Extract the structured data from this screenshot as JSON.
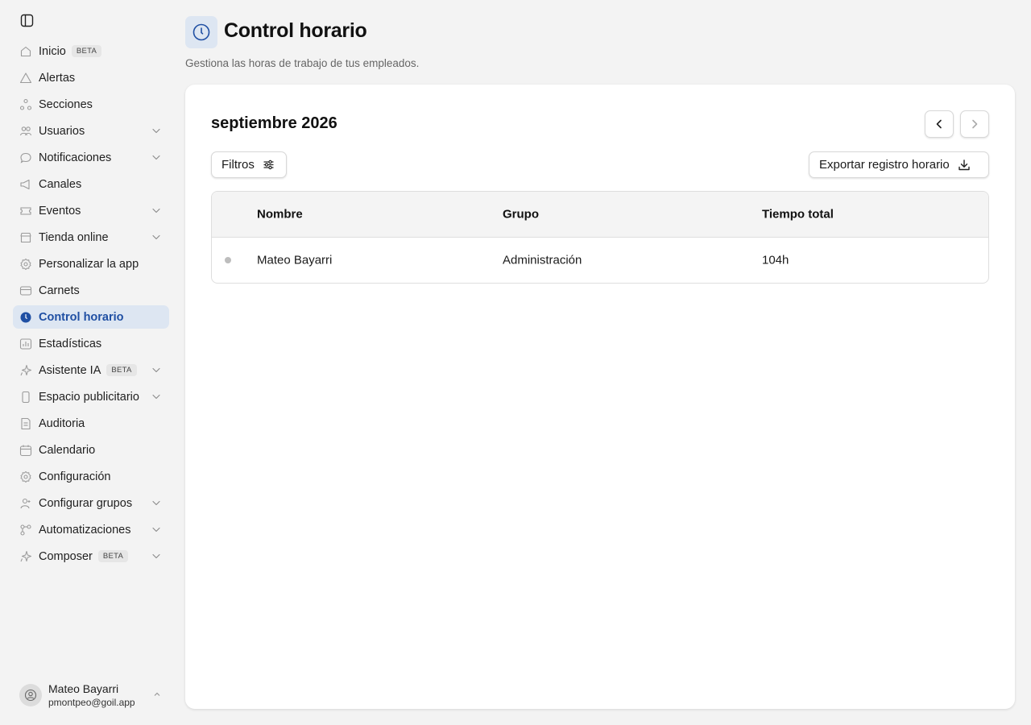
{
  "sidebar": {
    "items": [
      {
        "label": "Inicio",
        "icon": "home-icon",
        "badge": "BETA",
        "expandable": false
      },
      {
        "label": "Alertas",
        "icon": "alert-triangle-icon",
        "badge": "",
        "expandable": false
      },
      {
        "label": "Secciones",
        "icon": "sections-icon",
        "badge": "",
        "expandable": false
      },
      {
        "label": "Usuarios",
        "icon": "users-icon",
        "badge": "",
        "expandable": true
      },
      {
        "label": "Notificaciones",
        "icon": "message-bubble-icon",
        "badge": "",
        "expandable": true
      },
      {
        "label": "Canales",
        "icon": "megaphone-icon",
        "badge": "",
        "expandable": false
      },
      {
        "label": "Eventos",
        "icon": "ticket-icon",
        "badge": "",
        "expandable": true
      },
      {
        "label": "Tienda online",
        "icon": "store-icon",
        "badge": "",
        "expandable": true
      },
      {
        "label": "Personalizar la app",
        "icon": "settings-gear-icon",
        "badge": "",
        "expandable": false
      },
      {
        "label": "Carnets",
        "icon": "card-icon",
        "badge": "",
        "expandable": false
      },
      {
        "label": "Control horario",
        "icon": "clock-icon",
        "badge": "",
        "expandable": false,
        "active": true
      },
      {
        "label": "Estadísticas",
        "icon": "bar-chart-icon",
        "badge": "",
        "expandable": false
      },
      {
        "label": "Asistente IA",
        "icon": "sparkle-icon",
        "badge": "BETA",
        "expandable": true
      },
      {
        "label": "Espacio publicitario",
        "icon": "phone-icon",
        "badge": "",
        "expandable": true
      },
      {
        "label": "Auditoria",
        "icon": "audit-document-icon",
        "badge": "",
        "expandable": false
      },
      {
        "label": "Calendario",
        "icon": "calendar-icon",
        "badge": "",
        "expandable": false
      },
      {
        "label": "Configuración",
        "icon": "gear-icon",
        "badge": "",
        "expandable": false
      },
      {
        "label": "Configurar grupos",
        "icon": "user-group-icon",
        "badge": "",
        "expandable": true
      },
      {
        "label": "Automatizaciones",
        "icon": "workflow-icon",
        "badge": "",
        "expandable": true
      },
      {
        "label": "Composer",
        "icon": "sparkle-icon",
        "badge": "BETA",
        "expandable": true
      }
    ],
    "user": {
      "name": "Mateo Bayarri",
      "email": "pmontpeo@goil.app"
    }
  },
  "header": {
    "title": "Control horario",
    "subtitle": "Gestiona las horas de trabajo de tus empleados."
  },
  "card": {
    "month": "septiembre 2026",
    "filters_label": "Filtros",
    "export_label": "Exportar registro horario",
    "table": {
      "columns": [
        "Nombre",
        "Grupo",
        "Tiempo total"
      ],
      "rows": [
        {
          "name": "Mateo Bayarri",
          "group": "Administración",
          "total": "104h"
        }
      ]
    }
  },
  "colors": {
    "accent": "#1f4fa3",
    "active_bg": "#dde6f2",
    "background": "#f3f3f3"
  }
}
